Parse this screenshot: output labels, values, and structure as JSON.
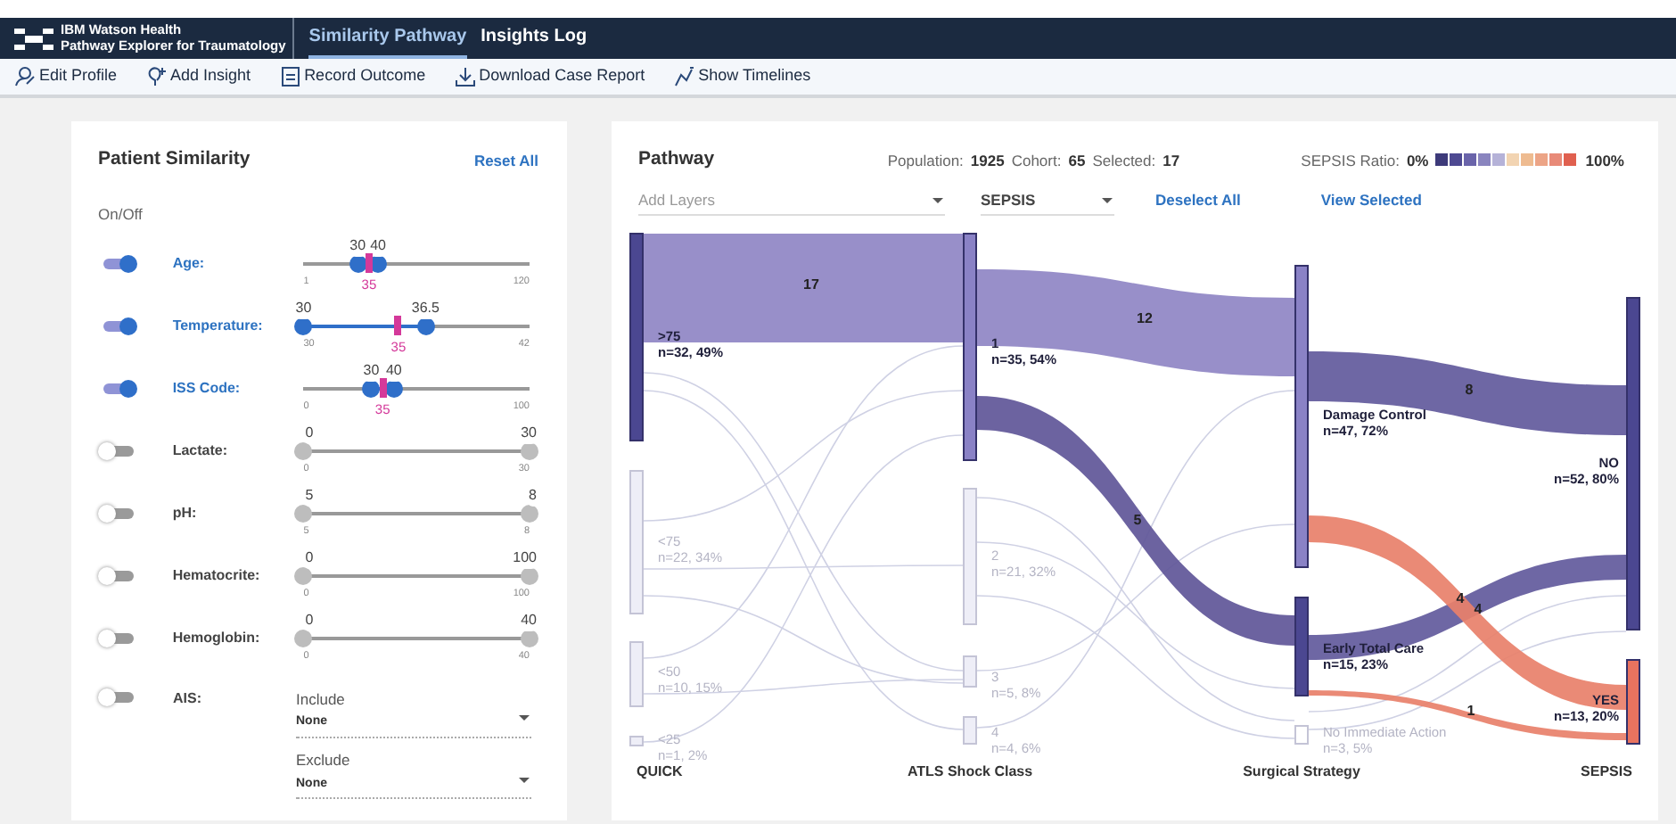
{
  "header": {
    "brand": [
      "IBM Watson Health",
      "Pathway Explorer for Traumatology"
    ],
    "tabs": [
      {
        "label": "Similarity Pathway",
        "selected": true
      },
      {
        "label": "Insights Log",
        "selected": false
      }
    ]
  },
  "toolbar": [
    {
      "label": "Edit Profile",
      "kind": "profile"
    },
    {
      "label": "Add Insight",
      "kind": "insight"
    },
    {
      "label": "Record Outcome",
      "kind": "record"
    },
    {
      "label": "Download Case Report",
      "kind": "download"
    },
    {
      "label": "Show Timelines",
      "kind": "timelines"
    }
  ],
  "similarity": {
    "title": "Patient Similarity",
    "reset": "Reset All",
    "onoff": "On/Off",
    "filters": [
      {
        "kind": "range",
        "label": "Age:",
        "on": true,
        "min": "1",
        "max": "120",
        "thumbs": [
          {
            "value": "30",
            "level": 0.24
          },
          {
            "value": "40",
            "level": 0.33
          }
        ],
        "marker": {
          "value": "35",
          "level": 0.29
        }
      },
      {
        "kind": "range",
        "label": "Temperature:",
        "on": true,
        "min": "30",
        "max": "42",
        "thumbs": [
          {
            "value": "30",
            "level": 0
          },
          {
            "value": "36.5",
            "level": 0.54
          }
        ],
        "marker": {
          "value": "35",
          "level": 0.42
        }
      },
      {
        "kind": "range",
        "label": "ISS Code:",
        "on": true,
        "min": "0",
        "max": "100",
        "thumbs": [
          {
            "value": "30",
            "level": 0.3
          },
          {
            "value": "40",
            "level": 0.4
          }
        ],
        "marker": {
          "value": "35",
          "level": 0.35
        }
      },
      {
        "kind": "range",
        "label": "Lactate:",
        "on": false,
        "min": "0",
        "max": "30",
        "thumbs": [
          {
            "value": "0",
            "level": 0
          },
          {
            "value": "30",
            "level": 1
          }
        ]
      },
      {
        "kind": "range",
        "label": "pH:",
        "on": false,
        "min": "5",
        "max": "8",
        "thumbs": [
          {
            "value": "5",
            "level": 0
          },
          {
            "value": "8",
            "level": 1
          }
        ]
      },
      {
        "kind": "range",
        "label": "Hematocrite:",
        "on": false,
        "min": "0",
        "max": "100",
        "thumbs": [
          {
            "value": "0",
            "level": 0
          },
          {
            "value": "100",
            "level": 1
          }
        ]
      },
      {
        "kind": "range",
        "label": "Hemoglobin:",
        "on": false,
        "min": "0",
        "max": "40",
        "thumbs": [
          {
            "value": "0",
            "level": 0
          },
          {
            "value": "40",
            "level": 1
          }
        ]
      },
      {
        "kind": "select",
        "label": "AIS:",
        "on": false,
        "selects": [
          {
            "label": "Include",
            "value": "None"
          },
          {
            "label": "Exclude",
            "value": "None"
          }
        ]
      }
    ]
  },
  "pathway": {
    "title": "Pathway",
    "stats": [
      {
        "label": "Population:",
        "value": "1925"
      },
      {
        "label": "Cohort:",
        "value": "65"
      },
      {
        "label": "Selected:",
        "value": "17"
      }
    ],
    "ratio": {
      "label": "SEPSIS Ratio:",
      "low": "0%",
      "high": "100%",
      "swatches": [
        {
          "color": "#3d3a7a"
        },
        {
          "color": "#4e4a92"
        },
        {
          "color": "#6a64aa"
        },
        {
          "color": "#8a85bf"
        },
        {
          "color": "#b5b2d8"
        },
        {
          "color": "#f2d4b2"
        },
        {
          "color": "#eebb90"
        },
        {
          "color": "#eca486"
        },
        {
          "color": "#e88a78"
        },
        {
          "color": "#e0604f"
        }
      ]
    },
    "layers_placeholder": "Add Layers",
    "outcome": "SEPSIS",
    "deselect": "Deselect All",
    "view_selected": "View Selected",
    "sankey": {
      "columns": [
        {
          "title": "QUICK",
          "nodes": [
            {
              "label": ">75",
              "stats": "n=32, 49%",
              "color": "#4b4791",
              "active": true
            },
            {
              "label": "<75",
              "stats": "n=22, 34%",
              "color": "#eeeef7",
              "active": false
            },
            {
              "label": "<50",
              "stats": "n=10, 15%",
              "color": "#eeeef7",
              "active": false
            },
            {
              "label": "<25",
              "stats": "n=1, 2%",
              "color": "#eeeef7",
              "active": false
            }
          ]
        },
        {
          "title": "ATLS Shock Class",
          "nodes": [
            {
              "label": "1",
              "stats": "n=35, 54%",
              "color": "#8a82c6",
              "active": true
            },
            {
              "label": "2",
              "stats": "n=21, 32%",
              "color": "#eeeef7",
              "active": false
            },
            {
              "label": "3",
              "stats": "n=5, 8%",
              "color": "#eeeef7",
              "active": false
            },
            {
              "label": "4",
              "stats": "n=4, 6%",
              "color": "#eeeef7",
              "active": false
            }
          ]
        },
        {
          "title": "Surgical Strategy",
          "nodes": [
            {
              "label": "Damage Control",
              "stats": "n=47, 72%",
              "color": "#8a82c6",
              "active": true
            },
            {
              "label": "Early Total Care",
              "stats": "n=15, 23%",
              "color": "#4b4791",
              "active": true
            },
            {
              "label": "No Immediate Action",
              "stats": "n=3, 5%",
              "color": "#ffffff",
              "active": false
            }
          ]
        },
        {
          "title": "SEPSIS",
          "nodes": [
            {
              "label": "NO",
              "stats": "n=52, 80%",
              "color": "#4b4791",
              "active": true
            },
            {
              "label": "YES",
              "stats": "n=13, 20%",
              "color": "#e8735f",
              "active": true
            }
          ]
        }
      ],
      "flows": [
        {
          "value": "17",
          "color": "#8f86c4"
        },
        {
          "value": "12",
          "color": "#8f86c4"
        },
        {
          "value": "5",
          "color": "#5f5698"
        },
        {
          "value": "8",
          "color": "#625a9c"
        },
        {
          "value": "4",
          "color": "#625a9c"
        },
        {
          "value": "4",
          "color": "#e8806a"
        },
        {
          "value": "1",
          "color": "#e8806a"
        }
      ]
    }
  }
}
